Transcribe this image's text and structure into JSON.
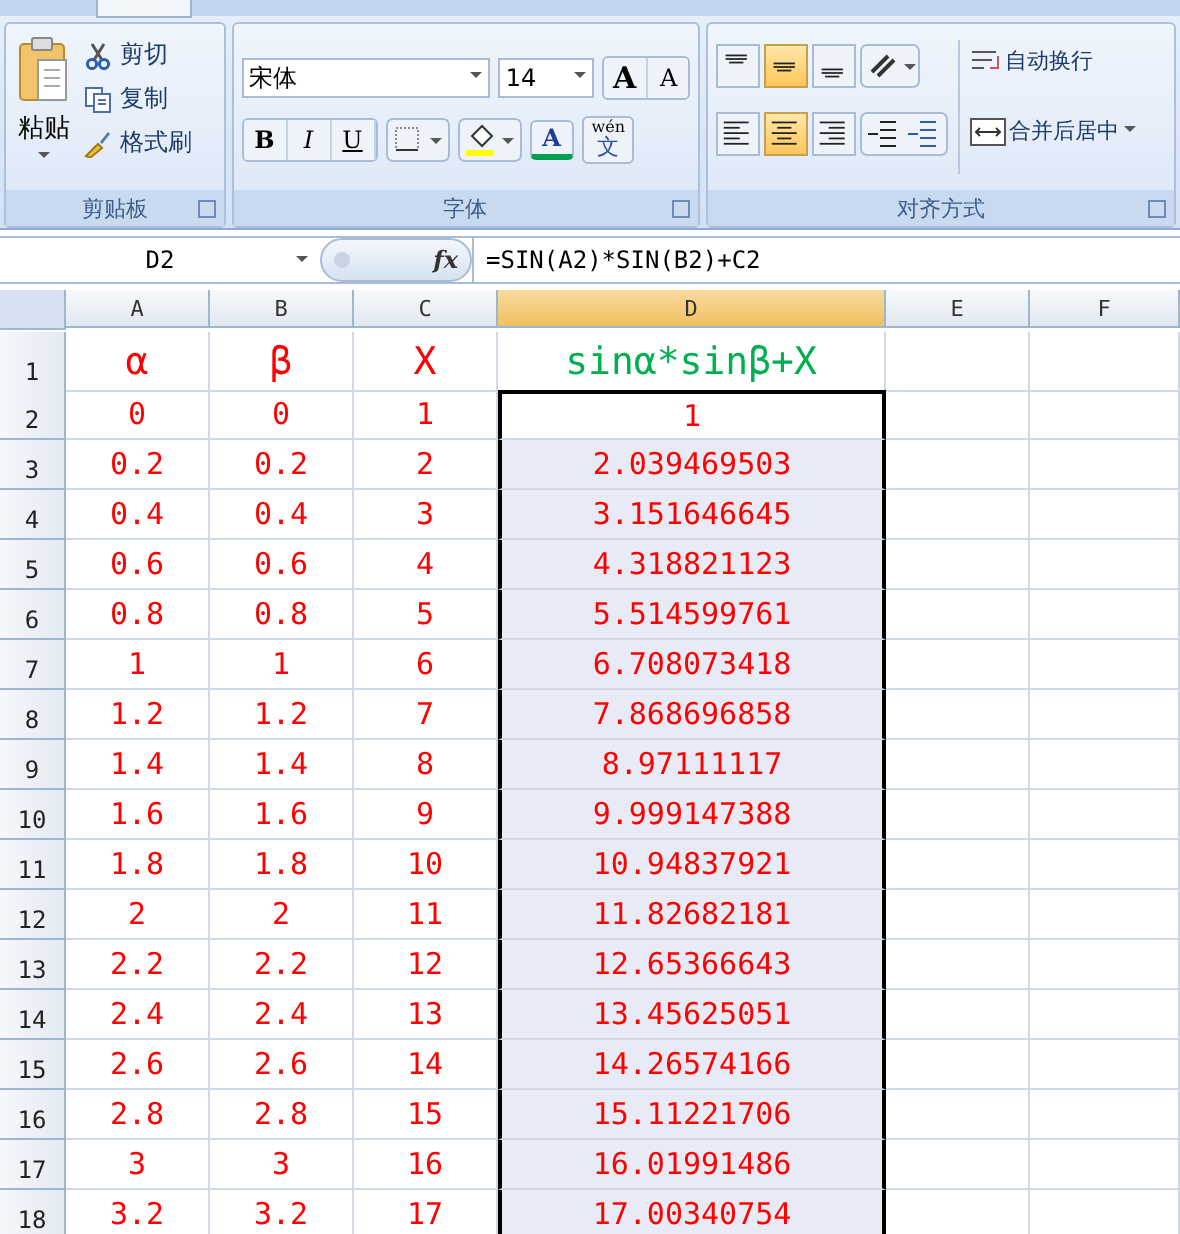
{
  "clipboard": {
    "paste": "粘贴",
    "items": [
      {
        "kind": "cut",
        "label": "剪切"
      },
      {
        "kind": "copy",
        "label": "复制"
      },
      {
        "kind": "brush",
        "label": "格式刷"
      }
    ],
    "title": "剪贴板"
  },
  "font": {
    "family": "宋体",
    "size": "14",
    "title": "字体",
    "styles": [
      {
        "kind": "bold",
        "label": "B"
      },
      {
        "kind": "italic",
        "label": "I"
      },
      {
        "kind": "underline",
        "label": "U"
      }
    ],
    "grow": "A",
    "shrink": "A",
    "color_letter": "A",
    "phonetic_top": "wén",
    "phonetic_bottom": "文"
  },
  "alignment": {
    "title": "对齐方式",
    "vertical": [
      {
        "kind": "top",
        "selected": false
      },
      {
        "kind": "middle",
        "selected": true
      },
      {
        "kind": "bottom",
        "selected": false
      }
    ],
    "horizontal": [
      {
        "kind": "left",
        "selected": false
      },
      {
        "kind": "center",
        "selected": true
      },
      {
        "kind": "right",
        "selected": false
      }
    ],
    "wrap": "自动换行",
    "merge": "合并后居中"
  },
  "formula_bar": {
    "name_box": "D2",
    "fx": "fx",
    "formula": "=SIN(A2)*SIN(B2)+C2"
  },
  "sheet": {
    "columns": [
      {
        "label": "A",
        "selected": false
      },
      {
        "label": "B",
        "selected": false
      },
      {
        "label": "C",
        "selected": false
      },
      {
        "label": "D",
        "selected": true
      },
      {
        "label": "E",
        "selected": false
      },
      {
        "label": "F",
        "selected": false
      }
    ],
    "header_row": {
      "number": "1",
      "cells": [
        "α",
        "β",
        "X",
        "sinα*sinβ+X"
      ]
    },
    "rows": [
      {
        "number": "2",
        "cells": [
          "0",
          "0",
          "1",
          "1"
        ]
      },
      {
        "number": "3",
        "cells": [
          "0.2",
          "0.2",
          "2",
          "2.039469503"
        ]
      },
      {
        "number": "4",
        "cells": [
          "0.4",
          "0.4",
          "3",
          "3.151646645"
        ]
      },
      {
        "number": "5",
        "cells": [
          "0.6",
          "0.6",
          "4",
          "4.318821123"
        ]
      },
      {
        "number": "6",
        "cells": [
          "0.8",
          "0.8",
          "5",
          "5.514599761"
        ]
      },
      {
        "number": "7",
        "cells": [
          "1",
          "1",
          "6",
          "6.708073418"
        ]
      },
      {
        "number": "8",
        "cells": [
          "1.2",
          "1.2",
          "7",
          "7.868696858"
        ]
      },
      {
        "number": "9",
        "cells": [
          "1.4",
          "1.4",
          "8",
          "8.97111117"
        ]
      },
      {
        "number": "10",
        "cells": [
          "1.6",
          "1.6",
          "9",
          "9.999147388"
        ]
      },
      {
        "number": "11",
        "cells": [
          "1.8",
          "1.8",
          "10",
          "10.94837921"
        ]
      },
      {
        "number": "12",
        "cells": [
          "2",
          "2",
          "11",
          "11.82682181"
        ]
      },
      {
        "number": "13",
        "cells": [
          "2.2",
          "2.2",
          "12",
          "12.65366643"
        ]
      },
      {
        "number": "14",
        "cells": [
          "2.4",
          "2.4",
          "13",
          "13.45625051"
        ]
      },
      {
        "number": "15",
        "cells": [
          "2.6",
          "2.6",
          "14",
          "14.26574166"
        ]
      },
      {
        "number": "16",
        "cells": [
          "2.8",
          "2.8",
          "15",
          "15.11221706"
        ]
      },
      {
        "number": "17",
        "cells": [
          "3",
          "3",
          "16",
          "16.01991486"
        ]
      },
      {
        "number": "18",
        "cells": [
          "3.2",
          "3.2",
          "17",
          "17.00340754"
        ]
      }
    ]
  }
}
